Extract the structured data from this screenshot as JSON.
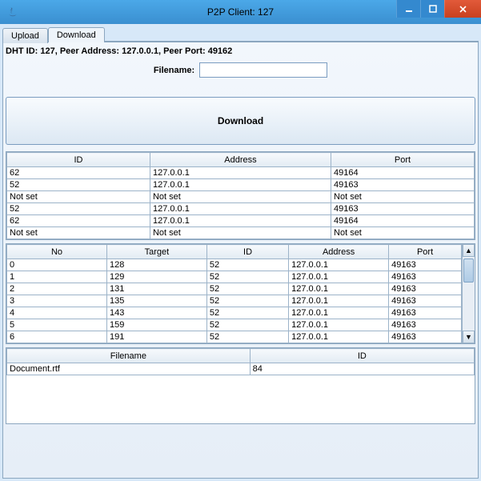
{
  "window": {
    "title": "P2P Client: 127"
  },
  "tabs": {
    "upload": "Upload",
    "download": "Download"
  },
  "info_line": "DHT ID: 127, Peer Address: 127.0.0.1, Peer Port: 49162",
  "filename_label": "Filename:",
  "filename_value": "",
  "download_button": "Download",
  "peer_table": {
    "headers": {
      "id": "ID",
      "address": "Address",
      "port": "Port"
    },
    "rows": [
      {
        "id": "62",
        "address": "127.0.0.1",
        "port": "49164"
      },
      {
        "id": "52",
        "address": "127.0.0.1",
        "port": "49163"
      },
      {
        "id": "Not set",
        "address": "Not set",
        "port": "Not set"
      },
      {
        "id": "52",
        "address": "127.0.0.1",
        "port": "49163"
      },
      {
        "id": "62",
        "address": "127.0.0.1",
        "port": "49164"
      },
      {
        "id": "Not set",
        "address": "Not set",
        "port": "Not set"
      }
    ]
  },
  "route_table": {
    "headers": {
      "no": "No",
      "target": "Target",
      "id": "ID",
      "address": "Address",
      "port": "Port"
    },
    "rows": [
      {
        "no": "0",
        "target": "128",
        "id": "52",
        "address": "127.0.0.1",
        "port": "49163"
      },
      {
        "no": "1",
        "target": "129",
        "id": "52",
        "address": "127.0.0.1",
        "port": "49163"
      },
      {
        "no": "2",
        "target": "131",
        "id": "52",
        "address": "127.0.0.1",
        "port": "49163"
      },
      {
        "no": "3",
        "target": "135",
        "id": "52",
        "address": "127.0.0.1",
        "port": "49163"
      },
      {
        "no": "4",
        "target": "143",
        "id": "52",
        "address": "127.0.0.1",
        "port": "49163"
      },
      {
        "no": "5",
        "target": "159",
        "id": "52",
        "address": "127.0.0.1",
        "port": "49163"
      },
      {
        "no": "6",
        "target": "191",
        "id": "52",
        "address": "127.0.0.1",
        "port": "49163"
      }
    ]
  },
  "files_table": {
    "headers": {
      "filename": "Filename",
      "id": "ID"
    },
    "rows": [
      {
        "filename": "Document.rtf",
        "id": "84"
      }
    ]
  }
}
